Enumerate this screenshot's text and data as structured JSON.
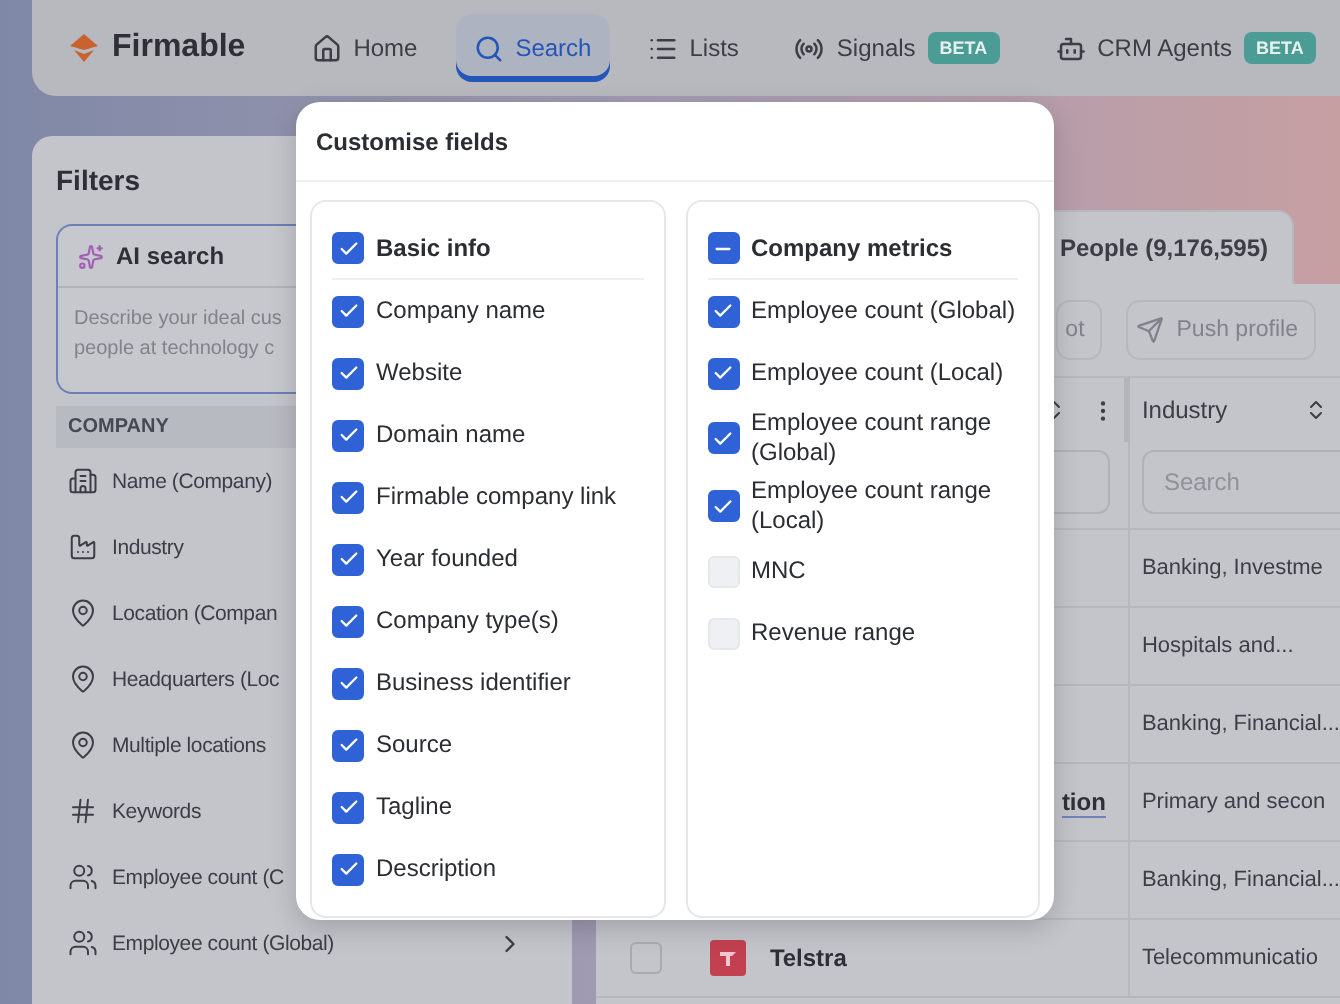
{
  "header": {
    "brand": "Firmable",
    "nav": [
      {
        "label": "Home",
        "selected": false
      },
      {
        "label": "Search",
        "selected": true
      },
      {
        "label": "Lists",
        "selected": false
      },
      {
        "label": "Signals",
        "badge": "BETA",
        "selected": false
      },
      {
        "label": "CRM Agents",
        "badge": "BETA",
        "selected": false
      }
    ]
  },
  "filters": {
    "title": "Filters",
    "ai_search": {
      "label": "AI search",
      "placeholder_lines": [
        "Describe your ideal cus",
        "people at technology c"
      ]
    },
    "section": "COMPANY",
    "items": [
      {
        "label": "Name (Company)"
      },
      {
        "label": "Industry"
      },
      {
        "label": "Location (Compan"
      },
      {
        "label": "Headquarters (Loc"
      },
      {
        "label": "Multiple locations"
      },
      {
        "label": "Keywords"
      },
      {
        "label": "Employee count (C"
      },
      {
        "label": "Employee count (Global)",
        "expandable": true
      }
    ]
  },
  "results": {
    "tab": "People (9,176,595)",
    "actions": [
      {
        "label": "ot"
      },
      {
        "label": "Push profile"
      }
    ],
    "column": "Industry",
    "search_placeholder": "Search",
    "rows": [
      {
        "industry": "Banking, Investme"
      },
      {
        "industry": "Hospitals and..."
      },
      {
        "industry": "Banking, Financial..."
      },
      {
        "name": "tion",
        "industry": "Primary and secon"
      },
      {
        "industry": "Banking, Financial..."
      },
      {
        "company": "Telstra",
        "checked": false,
        "industry": "Telecommunicatio"
      }
    ]
  },
  "modal": {
    "title": "Customise fields",
    "groups": [
      {
        "title": "Basic info",
        "checked": true,
        "fields": [
          {
            "label": "Company name",
            "checked": true
          },
          {
            "label": "Website",
            "checked": true
          },
          {
            "label": "Domain name",
            "checked": true
          },
          {
            "label": "Firmable company link",
            "checked": true
          },
          {
            "label": "Year founded",
            "checked": true
          },
          {
            "label": "Company type(s)",
            "checked": true
          },
          {
            "label": "Business identifier",
            "checked": true
          },
          {
            "label": "Source",
            "checked": true
          },
          {
            "label": "Tagline",
            "checked": true
          },
          {
            "label": "Description",
            "checked": true
          }
        ]
      },
      {
        "title": "Company metrics",
        "checked": true,
        "indeterminate": true,
        "fields": [
          {
            "label": "Employee count (Global)",
            "checked": true
          },
          {
            "label": "Employee count (Local)",
            "checked": true
          },
          {
            "label": "Employee count range (Global)",
            "checked": true
          },
          {
            "label": "Employee count range (Local)",
            "checked": true
          },
          {
            "label": "MNC",
            "checked": false
          },
          {
            "label": "Revenue range",
            "checked": false
          }
        ]
      }
    ]
  }
}
